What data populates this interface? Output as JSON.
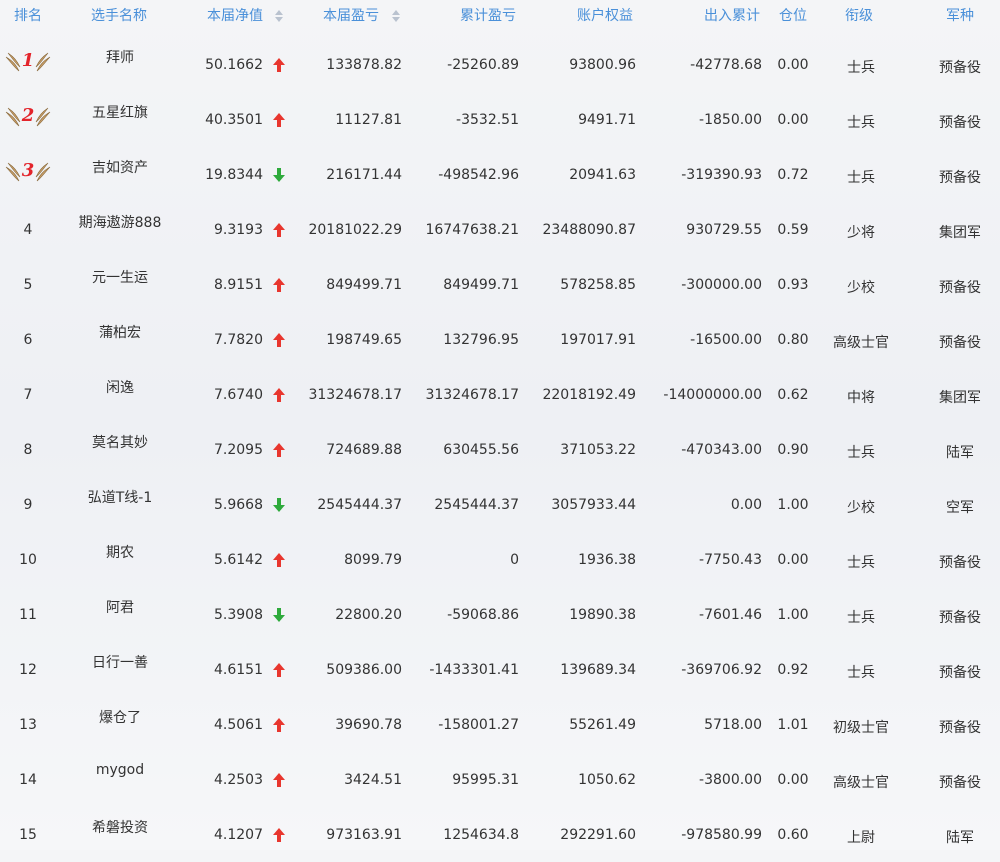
{
  "headers": [
    "排名",
    "选手名称",
    "本届净值",
    "本届盈亏",
    "累计盈亏",
    "账户权益",
    "出入累计",
    "仓位",
    "衔级",
    "军种"
  ],
  "colors": {
    "header_text": "#4a90d9",
    "up_arrow": "#e8362e",
    "down_arrow": "#2eaa3c",
    "text": "#333333",
    "medal": "#c9a06a",
    "medal_number": "#e3242b"
  },
  "rows": [
    {
      "rank": "1",
      "name": "拜师",
      "net": "50.1662",
      "trend": "up",
      "profit": "133878.82",
      "cum": "-25260.89",
      "equity": "93800.96",
      "flow": "-42778.68",
      "pos": "0.00",
      "rank_title": "士兵",
      "branch": "预备役"
    },
    {
      "rank": "2",
      "name": "五星红旗",
      "net": "40.3501",
      "trend": "up",
      "profit": "11127.81",
      "cum": "-3532.51",
      "equity": "9491.71",
      "flow": "-1850.00",
      "pos": "0.00",
      "rank_title": "士兵",
      "branch": "预备役"
    },
    {
      "rank": "3",
      "name": "吉如资产",
      "net": "19.8344",
      "trend": "down",
      "profit": "216171.44",
      "cum": "-498542.96",
      "equity": "20941.63",
      "flow": "-319390.93",
      "pos": "0.72",
      "rank_title": "士兵",
      "branch": "预备役"
    },
    {
      "rank": "4",
      "name": "期海遨游888",
      "net": "9.3193",
      "trend": "up",
      "profit": "20181022.29",
      "cum": "16747638.21",
      "equity": "23488090.87",
      "flow": "930729.55",
      "pos": "0.59",
      "rank_title": "少将",
      "branch": "集团军"
    },
    {
      "rank": "5",
      "name": "元一生运",
      "net": "8.9151",
      "trend": "up",
      "profit": "849499.71",
      "cum": "849499.71",
      "equity": "578258.85",
      "flow": "-300000.00",
      "pos": "0.93",
      "rank_title": "少校",
      "branch": "预备役"
    },
    {
      "rank": "6",
      "name": "蒲柏宏",
      "net": "7.7820",
      "trend": "up",
      "profit": "198749.65",
      "cum": "132796.95",
      "equity": "197017.91",
      "flow": "-16500.00",
      "pos": "0.80",
      "rank_title": "高级士官",
      "branch": "预备役"
    },
    {
      "rank": "7",
      "name": "闲逸",
      "net": "7.6740",
      "trend": "up",
      "profit": "31324678.17",
      "cum": "31324678.17",
      "equity": "22018192.49",
      "flow": "-14000000.00",
      "pos": "0.62",
      "rank_title": "中将",
      "branch": "集团军"
    },
    {
      "rank": "8",
      "name": "莫名其妙",
      "net": "7.2095",
      "trend": "up",
      "profit": "724689.88",
      "cum": "630455.56",
      "equity": "371053.22",
      "flow": "-470343.00",
      "pos": "0.90",
      "rank_title": "士兵",
      "branch": "陆军"
    },
    {
      "rank": "9",
      "name": "弘道T线-1",
      "net": "5.9668",
      "trend": "down",
      "profit": "2545444.37",
      "cum": "2545444.37",
      "equity": "3057933.44",
      "flow": "0.00",
      "pos": "1.00",
      "rank_title": "少校",
      "branch": "空军"
    },
    {
      "rank": "10",
      "name": "期农",
      "net": "5.6142",
      "trend": "up",
      "profit": "8099.79",
      "cum": "0",
      "equity": "1936.38",
      "flow": "-7750.43",
      "pos": "0.00",
      "rank_title": "士兵",
      "branch": "预备役"
    },
    {
      "rank": "11",
      "name": "阿君",
      "net": "5.3908",
      "trend": "down",
      "profit": "22800.20",
      "cum": "-59068.86",
      "equity": "19890.38",
      "flow": "-7601.46",
      "pos": "1.00",
      "rank_title": "士兵",
      "branch": "预备役"
    },
    {
      "rank": "12",
      "name": "日行一善",
      "net": "4.6151",
      "trend": "up",
      "profit": "509386.00",
      "cum": "-1433301.41",
      "equity": "139689.34",
      "flow": "-369706.92",
      "pos": "0.92",
      "rank_title": "士兵",
      "branch": "预备役"
    },
    {
      "rank": "13",
      "name": "爆仓了",
      "net": "4.5061",
      "trend": "up",
      "profit": "39690.78",
      "cum": "-158001.27",
      "equity": "55261.49",
      "flow": "5718.00",
      "pos": "1.01",
      "rank_title": "初级士官",
      "branch": "预备役"
    },
    {
      "rank": "14",
      "name": "mygod",
      "net": "4.2503",
      "trend": "up",
      "profit": "3424.51",
      "cum": "95995.31",
      "equity": "1050.62",
      "flow": "-3800.00",
      "pos": "0.00",
      "rank_title": "高级士官",
      "branch": "预备役"
    },
    {
      "rank": "15",
      "name": "希磐投资",
      "net": "4.1207",
      "trend": "up",
      "profit": "973163.91",
      "cum": "1254634.8",
      "equity": "292291.60",
      "flow": "-978580.99",
      "pos": "0.60",
      "rank_title": "上尉",
      "branch": "陆军"
    }
  ]
}
